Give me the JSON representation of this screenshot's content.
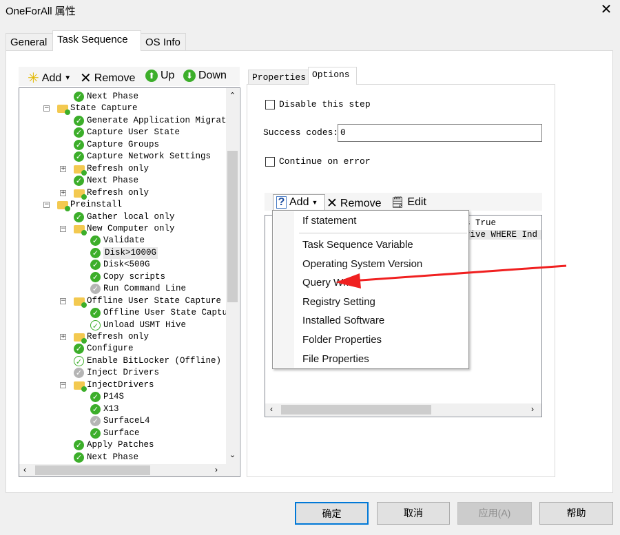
{
  "window": {
    "title": "OneForAll 属性",
    "close": "✕"
  },
  "tabs": [
    {
      "label": "General"
    },
    {
      "label": "Task Sequence",
      "active": true
    },
    {
      "label": "OS Info"
    }
  ],
  "tree_toolbar": {
    "add": "Add",
    "remove": "Remove",
    "up": "Up",
    "down": "Down"
  },
  "tree": [
    {
      "label": "Next Phase",
      "level": 1,
      "icon": "check"
    },
    {
      "label": "State Capture",
      "level": 0,
      "icon": "folder",
      "expander": "minus"
    },
    {
      "label": "Generate Application Migrat",
      "level": 1,
      "icon": "check"
    },
    {
      "label": "Capture User State",
      "level": 1,
      "icon": "check"
    },
    {
      "label": "Capture Groups",
      "level": 1,
      "icon": "check"
    },
    {
      "label": "Capture Network Settings",
      "level": 1,
      "icon": "check"
    },
    {
      "label": "Refresh only",
      "level": 1,
      "icon": "folder",
      "expander": "plus"
    },
    {
      "label": "Next Phase",
      "level": 1,
      "icon": "check"
    },
    {
      "label": "Refresh only",
      "level": 1,
      "icon": "folder",
      "expander": "plus"
    },
    {
      "label": "Preinstall",
      "level": 0,
      "icon": "folder",
      "expander": "minus"
    },
    {
      "label": "Gather local only",
      "level": 1,
      "icon": "check"
    },
    {
      "label": "New Computer only",
      "level": 1,
      "icon": "folder",
      "expander": "minus"
    },
    {
      "label": "Validate",
      "level": 2,
      "icon": "check"
    },
    {
      "label": "Disk>1000G",
      "level": 2,
      "icon": "check",
      "selected": true
    },
    {
      "label": "Disk<500G",
      "level": 2,
      "icon": "check"
    },
    {
      "label": "Copy scripts",
      "level": 2,
      "icon": "check"
    },
    {
      "label": "Run Command Line",
      "level": 2,
      "icon": "disabled"
    },
    {
      "label": "Offline User State Capture",
      "level": 1,
      "icon": "folder",
      "expander": "minus"
    },
    {
      "label": "Offline User State Captu",
      "level": 2,
      "icon": "check"
    },
    {
      "label": "Unload USMT Hive",
      "level": 2,
      "icon": "check-outline"
    },
    {
      "label": "Refresh only",
      "level": 1,
      "icon": "folder",
      "expander": "plus"
    },
    {
      "label": "Configure",
      "level": 1,
      "icon": "check"
    },
    {
      "label": "Enable BitLocker (Offline)",
      "level": 1,
      "icon": "check-outline"
    },
    {
      "label": "Inject Drivers",
      "level": 1,
      "icon": "disabled"
    },
    {
      "label": "InjectDrivers",
      "level": 1,
      "icon": "folder",
      "expander": "minus"
    },
    {
      "label": "P14S",
      "level": 2,
      "icon": "check"
    },
    {
      "label": "X13",
      "level": 2,
      "icon": "check"
    },
    {
      "label": "SurfaceL4",
      "level": 2,
      "icon": "disabled"
    },
    {
      "label": "Surface",
      "level": 2,
      "icon": "check"
    },
    {
      "label": "Apply Patches",
      "level": 1,
      "icon": "check"
    },
    {
      "label": "Next Phase",
      "level": 1,
      "icon": "check"
    }
  ],
  "right_tabs": [
    {
      "label": "Properties"
    },
    {
      "label": "Options",
      "active": true
    }
  ],
  "options": {
    "disable_step": "Disable this step",
    "disable_checked": false,
    "success_label": "Success codes:",
    "success_value": "0",
    "continue_on_error": "Continue on error",
    "continue_checked": false
  },
  "cond_toolbar": {
    "add": "Add",
    "remove": "Remove",
    "edit": "Edit"
  },
  "conditions": [
    "s True",
    "rive WHERE Ind"
  ],
  "add_menu": [
    "If statement",
    "Task Sequence Variable",
    "Operating System Version",
    "Query WMI",
    "Registry Setting",
    "Installed Software",
    "Folder Properties",
    "File Properties"
  ],
  "annotation": {
    "color": "#f02020",
    "points_to": "Query WMI"
  },
  "buttons": {
    "ok": "确定",
    "cancel": "取消",
    "apply": "应用(A)",
    "help": "帮助"
  }
}
